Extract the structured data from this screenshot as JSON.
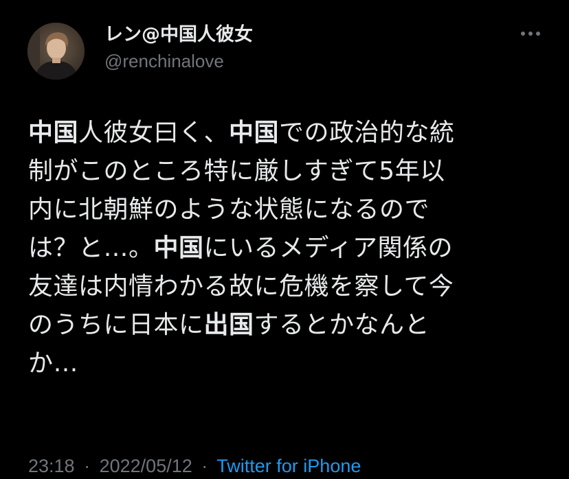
{
  "user": {
    "display_name": "レン@中国人彼女",
    "handle": "@renchinalove"
  },
  "tweet": {
    "lines": [
      [
        {
          "t": "中国",
          "b": true
        },
        {
          "t": "人彼女曰く、"
        },
        {
          "t": "中国",
          "b": true
        },
        {
          "t": "での政治的な統"
        }
      ],
      [
        {
          "t": "制がこのところ特に厳しすぎて5年以"
        }
      ],
      [
        {
          "t": "内に北朝鮮のような状態になるので"
        }
      ],
      [
        {
          "t": "は？と…。"
        },
        {
          "t": "中国",
          "b": true
        },
        {
          "t": "にいるメディア関係の"
        }
      ],
      [
        {
          "t": "友達は内情わかる故に危機を察して今"
        }
      ],
      [
        {
          "t": "のうちに日本に"
        },
        {
          "t": "出国",
          "b": true
        },
        {
          "t": "するとかなんと"
        }
      ],
      [
        {
          "t": "か…"
        }
      ]
    ]
  },
  "meta": {
    "time": "23:18",
    "separator_1": "·",
    "date": "2022/05/12",
    "separator_2": "·",
    "source": "Twitter for iPhone"
  },
  "icons": {
    "more": "more-horizontal-icon"
  },
  "colors": {
    "background": "#000000",
    "text": "#e7e9ea",
    "secondary": "#71767b",
    "link": "#1d9bf0"
  }
}
